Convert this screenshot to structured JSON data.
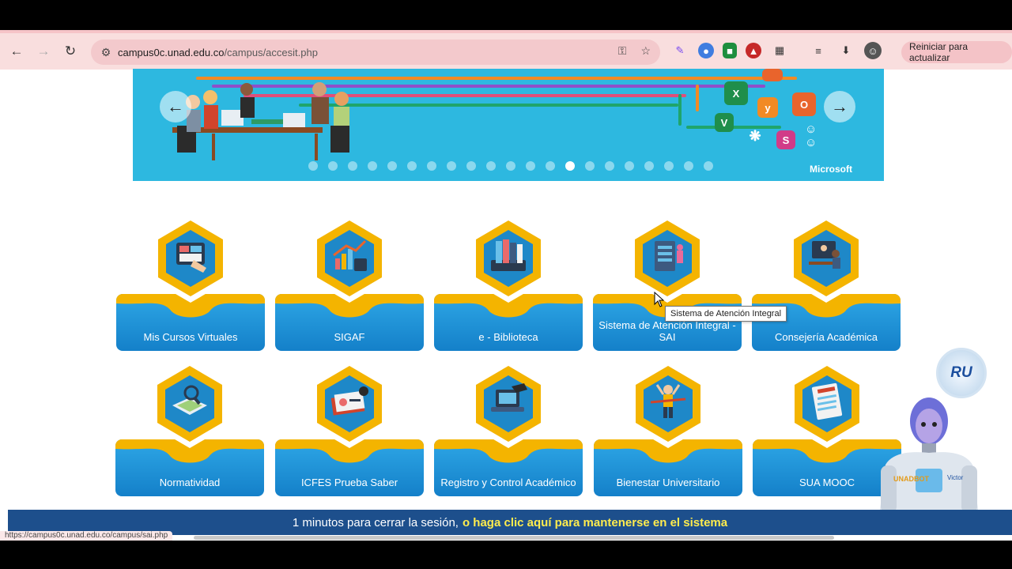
{
  "browser": {
    "url_host": "campus0c.unad.edu.co",
    "url_path": "/campus/accesit.php",
    "update_button": "Reiniciar para actualizar",
    "status_url": "https://campus0c.unad.edu.co/campus/sai.php"
  },
  "banner": {
    "brand": "Microsoft",
    "slide_count": 21,
    "active_slide": 13
  },
  "tiles_row1": [
    {
      "label": "Mis Cursos Virtuales"
    },
    {
      "label": "SIGAF"
    },
    {
      "label": "e - Biblioteca"
    },
    {
      "label": "Sistema de Atención Integral - SAI"
    },
    {
      "label": "Consejería Académica"
    }
  ],
  "tiles_row2": [
    {
      "label": "Normatividad"
    },
    {
      "label": "ICFES Prueba Saber"
    },
    {
      "label": "Registro y Control Académico"
    },
    {
      "label": "Bienestar Universitario"
    },
    {
      "label": "SUA MOOC"
    }
  ],
  "tooltip": "Sistema de Atención Integral",
  "session": {
    "message": "1 minutos para cerrar la sesión,",
    "link": "o haga clic aquí para mantenerse en el sistema"
  },
  "logo_text": "RU",
  "robot": {
    "badge_left": "UNADBOT",
    "badge_right": "Victor"
  },
  "colors": {
    "accent_blue": "#1d4f8c",
    "tile_blue": "#1e90d8",
    "tile_gold": "#f4b400",
    "banner_bg": "#2db8e0"
  }
}
